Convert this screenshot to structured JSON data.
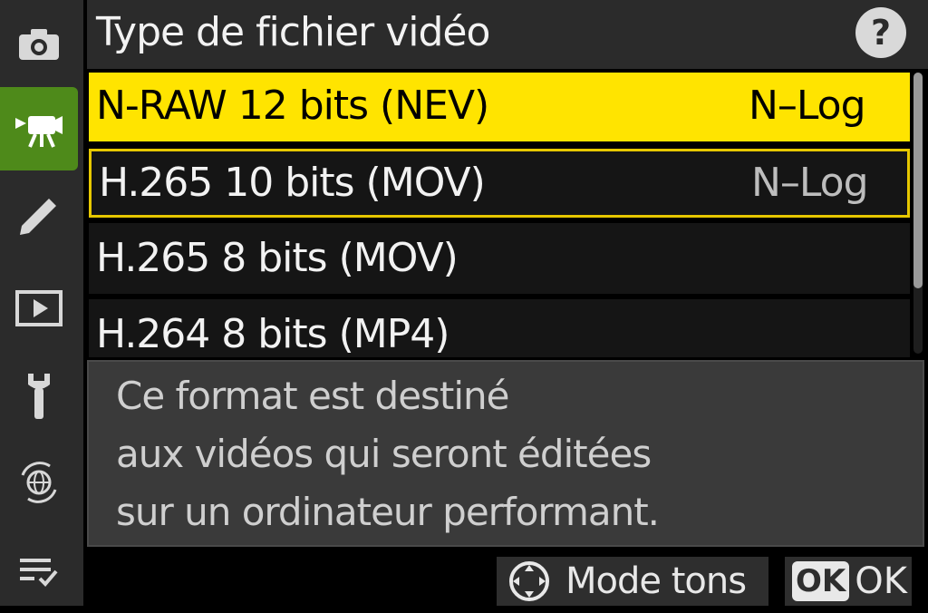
{
  "header": {
    "title": "Type de fichier vidéo",
    "help_label": "?"
  },
  "sidebar": {
    "items": [
      {
        "name": "photo-shooting-menu",
        "icon": "camera-icon"
      },
      {
        "name": "video-recording-menu",
        "icon": "video-camera-icon",
        "active": true
      },
      {
        "name": "custom-settings-menu",
        "icon": "pencil-icon"
      },
      {
        "name": "playback-menu",
        "icon": "play-icon"
      },
      {
        "name": "setup-menu",
        "icon": "wrench-icon"
      },
      {
        "name": "network-menu",
        "icon": "network-globe-icon"
      },
      {
        "name": "my-menu",
        "icon": "checklist-icon"
      }
    ]
  },
  "options": [
    {
      "label": "N-RAW 12 bits (NEV)",
      "value": "N–Log"
    },
    {
      "label": "H.265 10 bits (MOV)",
      "value": "N–Log"
    },
    {
      "label": "H.265 8 bits (MOV)",
      "value": ""
    },
    {
      "label": "H.264 8 bits (MP4)",
      "value": ""
    }
  ],
  "description": {
    "lines": [
      "Ce format est destiné",
      "aux vidéos qui seront éditées",
      "sur un ordinateur performant."
    ]
  },
  "footer": {
    "tone_label": "Mode tons",
    "ok_badge": "OK",
    "ok_label": "OK"
  },
  "colors": {
    "accent_yellow": "#ffe400",
    "sidebar_active": "#4e8a1a"
  }
}
